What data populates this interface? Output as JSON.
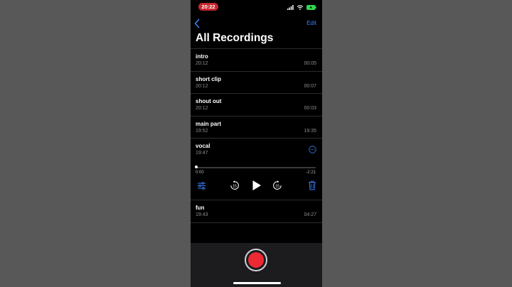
{
  "status_bar": {
    "time": "20:22"
  },
  "nav": {
    "edit_label": "Edit"
  },
  "title": "All Recordings",
  "recordings_before": [
    {
      "name": "intro",
      "date": "20:12",
      "duration": "00:05"
    },
    {
      "name": "short clip",
      "date": "20:12",
      "duration": "00:07"
    },
    {
      "name": "shout out",
      "date": "20:12",
      "duration": "00:03"
    },
    {
      "name": "main part",
      "date": "19:52",
      "duration": "19:35"
    }
  ],
  "expanded_recording": {
    "name": "vocal",
    "date": "19:47",
    "elapsed": "0:00",
    "remaining": "-2:21",
    "progress": 0.0
  },
  "recordings_after": [
    {
      "name": "fun",
      "date": "19:43",
      "duration": "04:27"
    }
  ],
  "colors": {
    "accent": "#3a82f7",
    "record": "#eb2a34",
    "badge": "#c4262e"
  },
  "icons": {
    "back": "chevron-left-icon",
    "more": "ellipsis-circle-icon",
    "options": "sliders-icon",
    "skip_back": "skip-back-15-icon",
    "play": "play-icon",
    "skip_forward": "skip-forward-15-icon",
    "delete": "trash-icon"
  }
}
